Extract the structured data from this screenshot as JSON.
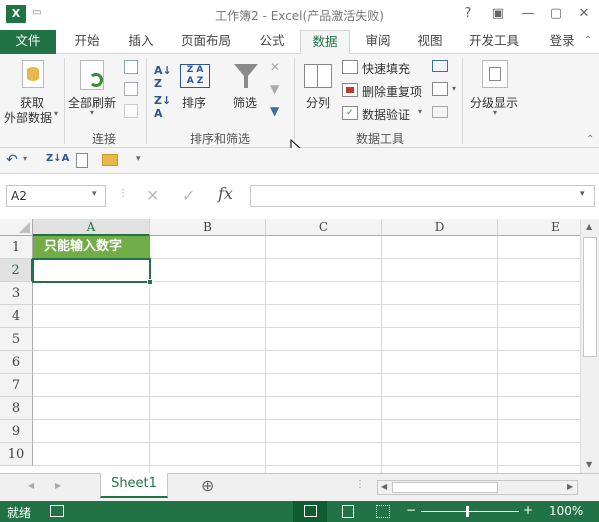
{
  "window": {
    "title": "工作簿2 - Excel(产品激活失败)",
    "app_icon": "X",
    "help": "?"
  },
  "tabs": [
    "文件",
    "开始",
    "插入",
    "页面布局",
    "公式",
    "数据",
    "审阅",
    "视图",
    "开发工具",
    "登录"
  ],
  "active_tab": "数据",
  "ribbon": {
    "get_external": {
      "line1": "获取",
      "line2": "外部数据"
    },
    "refresh_all": "全部刷新",
    "group_connect": "连接",
    "sort": "排序",
    "filter": "筛选",
    "group_sort_filter": "排序和筛选",
    "text_to_columns": "分列",
    "flash_fill": "快速填充",
    "remove_duplicates": "删除重复项",
    "data_validation": "数据验证",
    "group_data_tools": "数据工具",
    "outline": "分级显示"
  },
  "formula_bar": {
    "name_box": "A2",
    "fx": "fx",
    "formula": ""
  },
  "columns": [
    "A",
    "B",
    "C",
    "D",
    "E"
  ],
  "rows": [
    "1",
    "2",
    "3",
    "4",
    "5",
    "6",
    "7",
    "8",
    "9",
    "10"
  ],
  "cells": {
    "A1": "只能输入数字"
  },
  "sheets": {
    "tab": "Sheet1",
    "add": "⊕"
  },
  "status": {
    "ready": "就绪",
    "zoom": "100%"
  },
  "colors": {
    "accent": "#217346",
    "cell_fill": "#70ad47"
  }
}
